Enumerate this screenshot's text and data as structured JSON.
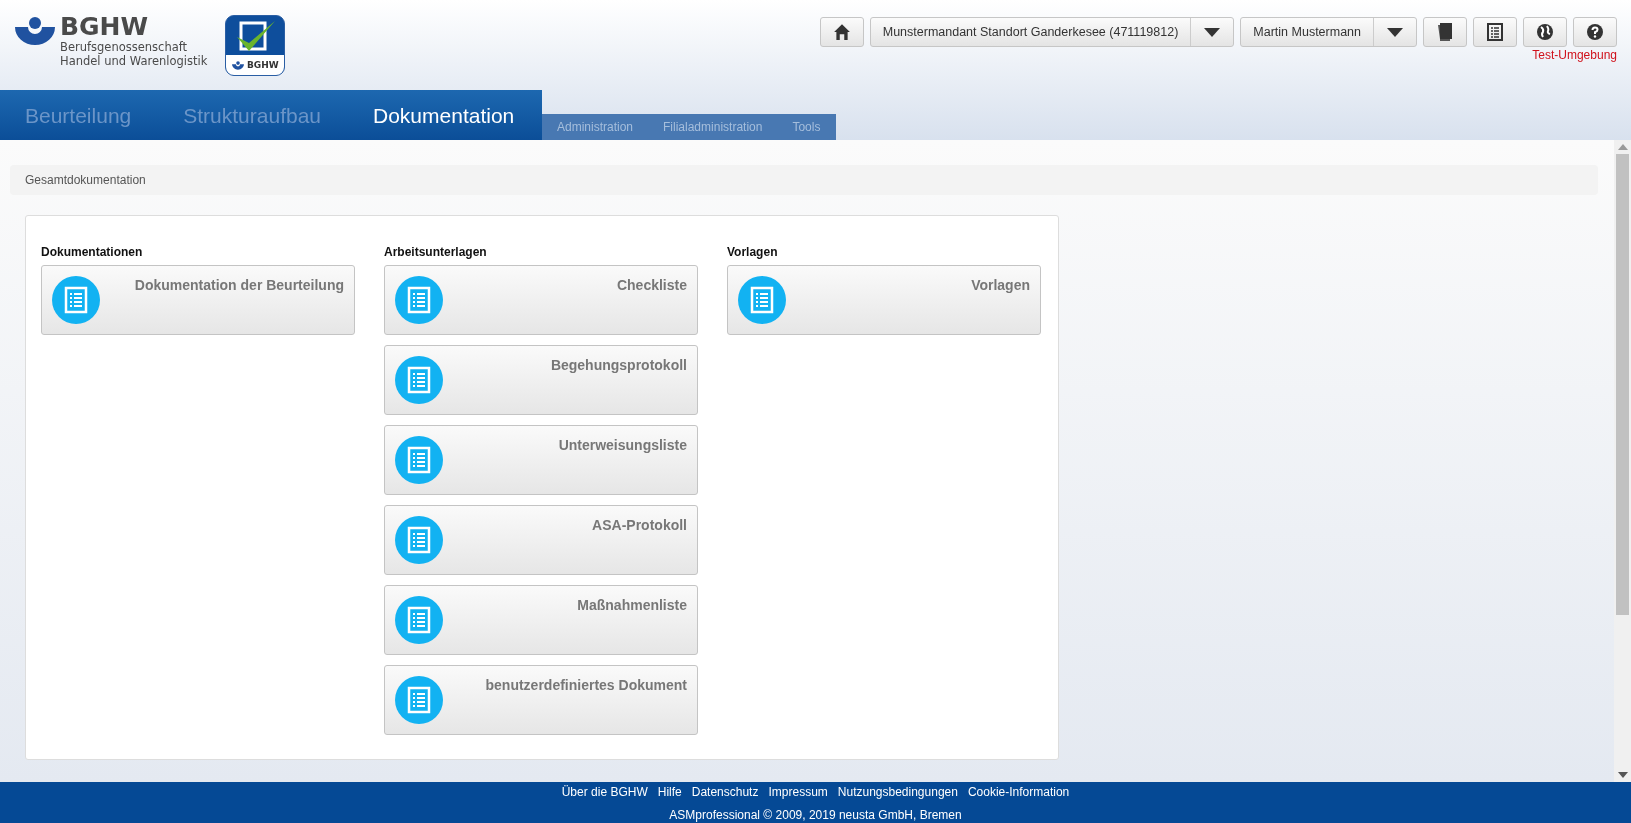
{
  "logo": {
    "name": "BGHW",
    "lines": [
      "Berufsgenossenschaft",
      "Handel und Warenlogistik"
    ],
    "app_icon_label": "BGHW"
  },
  "header": {
    "tenant": "Munstermandant Standort Ganderkesee (471119812)",
    "user": "Martin Mustermann",
    "environment": "Test-Umgebung"
  },
  "main_tabs": [
    {
      "label": "Beurteilung",
      "selected": false
    },
    {
      "label": "Strukturaufbau",
      "selected": false
    },
    {
      "label": "Dokumentation",
      "selected": true
    }
  ],
  "sub_tabs": [
    "Administration",
    "Filialadministration",
    "Tools"
  ],
  "breadcrumb": "Gesamtdokumentation",
  "columns": [
    {
      "heading": "Dokumentationen",
      "tiles": [
        "Dokumentation der Beurteilung"
      ]
    },
    {
      "heading": "Arbeitsunterlagen",
      "tiles": [
        "Checkliste",
        "Begehungsprotokoll",
        "Unterweisungsliste",
        "ASA-Protokoll",
        "Maßnahmenliste",
        "benutzerdefiniertes Dokument"
      ]
    },
    {
      "heading": "Vorlagen",
      "tiles": [
        "Vorlagen"
      ]
    }
  ],
  "footer": {
    "links": [
      "Über die BGHW",
      "Hilfe",
      "Datenschutz",
      "Impressum",
      "Nutzungsbedingungen",
      "Cookie-Information"
    ],
    "copyright": "ASMprofessional © 2009, 2019 neusta GmbH, Bremen"
  }
}
